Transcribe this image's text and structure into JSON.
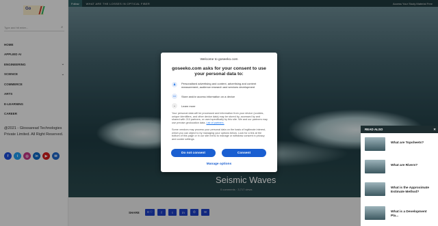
{
  "topbar": {
    "follow": "Follow",
    "ticker": "WHAT ARE THE LOSSES IN OPTICAL FIBER",
    "access": "Access Your Study Material Free"
  },
  "logo": {
    "text": "Go"
  },
  "search": {
    "placeholder": "Type and hit enter..."
  },
  "nav": [
    {
      "label": "Home",
      "has_chevron": false
    },
    {
      "label": "Applied AI",
      "has_chevron": false
    },
    {
      "label": "Engineering",
      "has_chevron": true
    },
    {
      "label": "Science",
      "has_chevron": true
    },
    {
      "label": "Commerce",
      "has_chevron": false
    },
    {
      "label": "Arts",
      "has_chevron": false
    },
    {
      "label": "E-Learning",
      "has_chevron": false
    },
    {
      "label": "Career",
      "has_chevron": false
    }
  ],
  "copyright": "@2021 - Glossaread Technologies Private Limited. All Right Reserved.",
  "socials": [
    {
      "icon": "facebook-icon",
      "glyph": "f",
      "color": "#1d4ed8"
    },
    {
      "icon": "twitter-icon",
      "glyph": "t",
      "color": "#1d9bf0"
    },
    {
      "icon": "instagram-icon",
      "glyph": "◎",
      "color": "#c13584"
    },
    {
      "icon": "linkedin-icon",
      "glyph": "in",
      "color": "#0a66c2"
    },
    {
      "icon": "youtube-icon",
      "glyph": "▶",
      "color": "#d11d1d"
    },
    {
      "icon": "email-icon",
      "glyph": "✉",
      "color": "#1e66c8"
    }
  ],
  "hero": {
    "title": "Seismic Waves",
    "meta": "0 comments · 3,717 views"
  },
  "share": {
    "label": "SHARE",
    "buttons": [
      {
        "icon": "share-count-icon",
        "glyph": "0 ♡"
      },
      {
        "icon": "facebook-icon",
        "glyph": "f"
      },
      {
        "icon": "twitter-icon",
        "glyph": "t"
      },
      {
        "icon": "linkedin-icon",
        "glyph": "in"
      },
      {
        "icon": "whatsapp-icon",
        "glyph": "✆"
      },
      {
        "icon": "email-icon",
        "glyph": "✉"
      }
    ]
  },
  "read_also": {
    "heading": "READ ALSO",
    "close": "✕",
    "items": [
      {
        "title": "What are Topsheets?"
      },
      {
        "title": "What are Rivers?"
      },
      {
        "title": "What is the Approximate Estimate Method?"
      },
      {
        "title": "What is a Development Pla..."
      }
    ]
  },
  "consent": {
    "welcome": "Welcome to goseeko.com",
    "title": "goseeko.com asks for your consent to use your personal data to:",
    "purposes": [
      {
        "icon": "person-icon",
        "glyph": "♟",
        "text": "Personalised advertising and content, advertising and content measurement, audience research and services development"
      },
      {
        "icon": "device-icon",
        "glyph": "▭",
        "text": "Store and/or access information on a device"
      }
    ],
    "learn_more": "Learn more",
    "body1": "Your personal data will be processed and information from your device (cookies, unique identifiers, and other device data) may be stored by, accessed by and shared with 210 partners, or used specifically by this site. We and our partners may use precise geolocation data.",
    "body1_link": "List of partners.",
    "body2": "Some vendors may process your personal data on the basis of legitimate interest, which you can object to by managing your options below. Look for a link at the bottom of this page or in our site menu to manage or withdraw consent in privacy and cookie settings.",
    "btn_no": "Do not consent",
    "btn_yes": "Consent",
    "manage": "Manage options"
  }
}
